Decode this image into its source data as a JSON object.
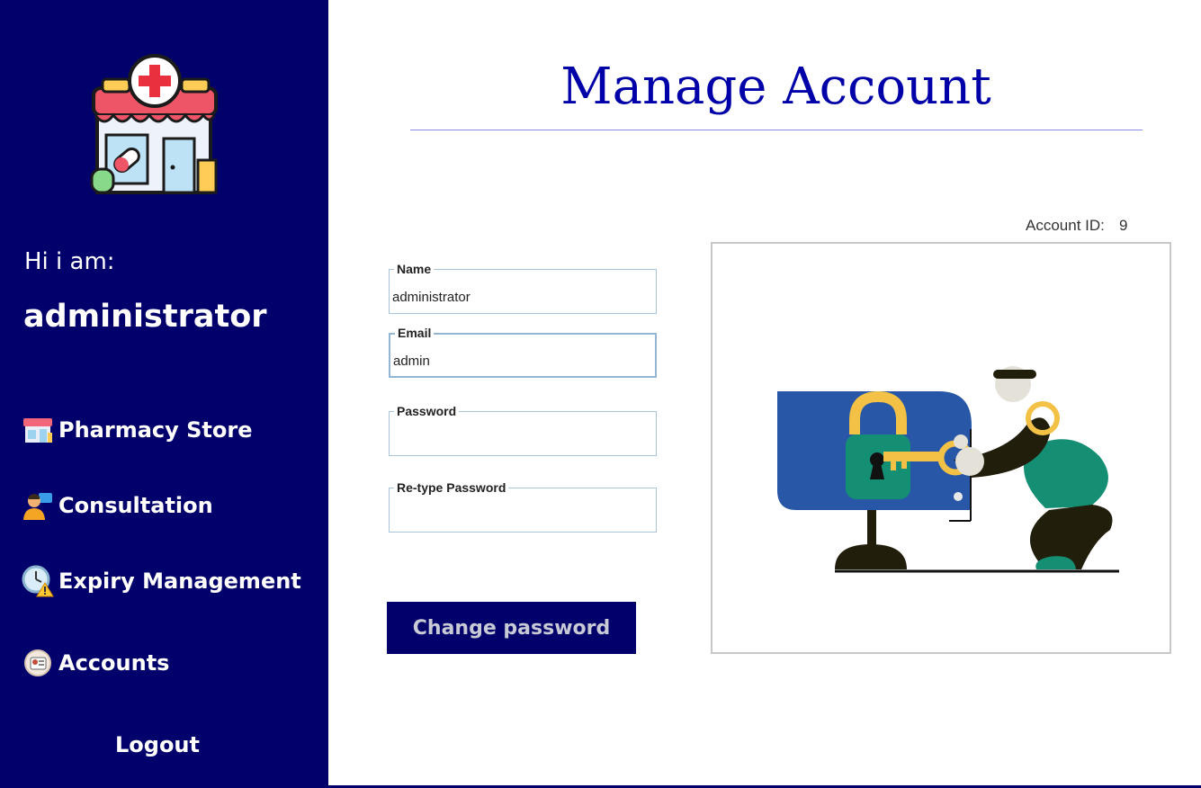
{
  "sidebar": {
    "greeting": "Hi i am:",
    "username": "administrator",
    "nav": [
      {
        "label": "Pharmacy Store",
        "icon": "pharmacy-store-icon"
      },
      {
        "label": "Consultation",
        "icon": "consultation-icon"
      },
      {
        "label": "Expiry Management",
        "icon": "expiry-clock-icon"
      },
      {
        "label": "Accounts",
        "icon": "accounts-icon"
      }
    ],
    "logout_label": "Logout"
  },
  "main": {
    "title": "Manage Account",
    "account_id_label": "Account ID:",
    "account_id_value": "9",
    "form": {
      "name": {
        "label": "Name",
        "value": "administrator"
      },
      "email": {
        "label": "Email",
        "value": "admin"
      },
      "password": {
        "label": "Password",
        "value": ""
      },
      "retype_password": {
        "label": "Re-type Password",
        "value": ""
      }
    },
    "change_password_label": "Change password",
    "illustration": "lock-and-key-illustration"
  },
  "colors": {
    "sidebar_bg": "#02006a",
    "title": "#0000a8",
    "button_bg": "#02006a",
    "field_border": "#a8c4dc"
  }
}
